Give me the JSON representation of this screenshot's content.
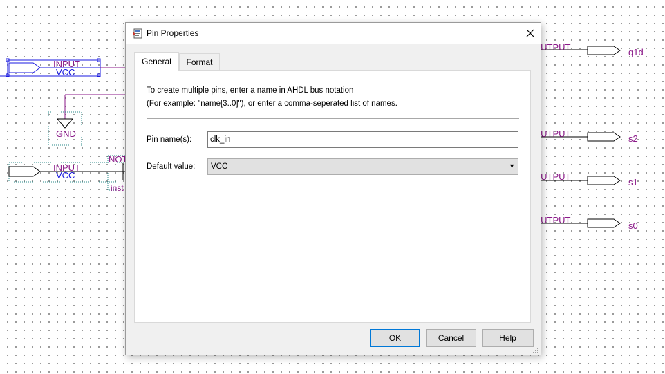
{
  "schematic": {
    "input_pin_1": {
      "type_label": "INPUT",
      "default_label": "VCC"
    },
    "gnd_symbol": {
      "label": "GND"
    },
    "input_pin_2": {
      "type_label": "INPUT",
      "default_label": "VCC"
    },
    "not_gate": {
      "label": "NOT",
      "inst_label": "inst"
    },
    "outputs": [
      {
        "type_label": "OUTPUT",
        "name": "q1d"
      },
      {
        "type_label": "OUTPUT",
        "name": "s2"
      },
      {
        "type_label": "OUTPUT",
        "name": "s1"
      },
      {
        "type_label": "OUTPUT",
        "name": "s0"
      }
    ],
    "colors": {
      "label": "#8b1a89",
      "wire": "#8b1a89",
      "selection": "#1a1ae0"
    }
  },
  "dialog": {
    "title": "Pin Properties",
    "icon": "pin-properties-icon",
    "tabs": [
      {
        "label": "General",
        "active": true
      },
      {
        "label": "Format",
        "active": false
      }
    ],
    "description_line1": "To create multiple pins, enter a name in AHDL bus notation",
    "description_line2": "(For example: \"name[3..0]\"), or enter a comma-seperated list of names.",
    "pin_names_label": "Pin name(s):",
    "pin_names_value": "clk_in",
    "default_value_label": "Default value:",
    "default_value_selected": "VCC",
    "buttons": {
      "ok": "OK",
      "cancel": "Cancel",
      "help": "Help"
    },
    "accent_color": "#0078d7"
  }
}
